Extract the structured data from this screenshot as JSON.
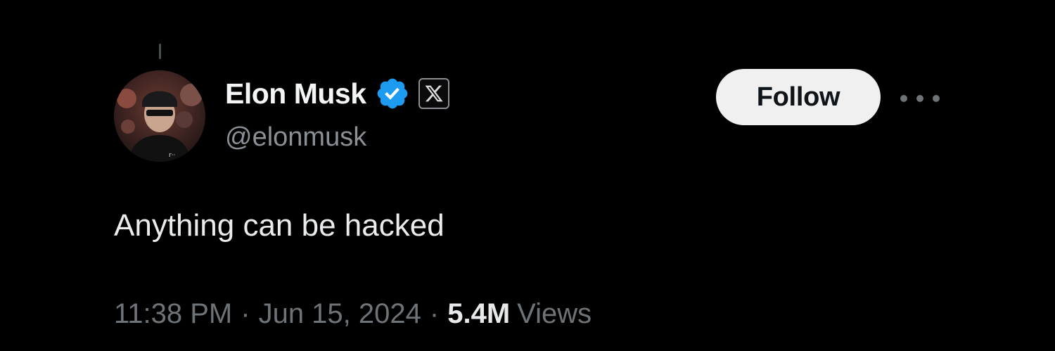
{
  "author": {
    "display_name": "Elon Musk",
    "handle": "@elonmusk",
    "verified_icon": "verified-badge-icon",
    "affiliation_icon": "x-logo-icon"
  },
  "actions": {
    "follow_label": "Follow",
    "more_icon": "more-horizontal-icon"
  },
  "tweet": {
    "text": "Anything can be hacked",
    "time": "11:38 PM",
    "separator": "·",
    "date": "Jun 15, 2024",
    "views_count": "5.4M",
    "views_label": "Views"
  },
  "colors": {
    "background": "#000000",
    "verified_blue": "#1d9bf0",
    "text_primary": "#e7e9ea",
    "text_secondary": "#71767b",
    "follow_bg": "#f0f0f0"
  }
}
